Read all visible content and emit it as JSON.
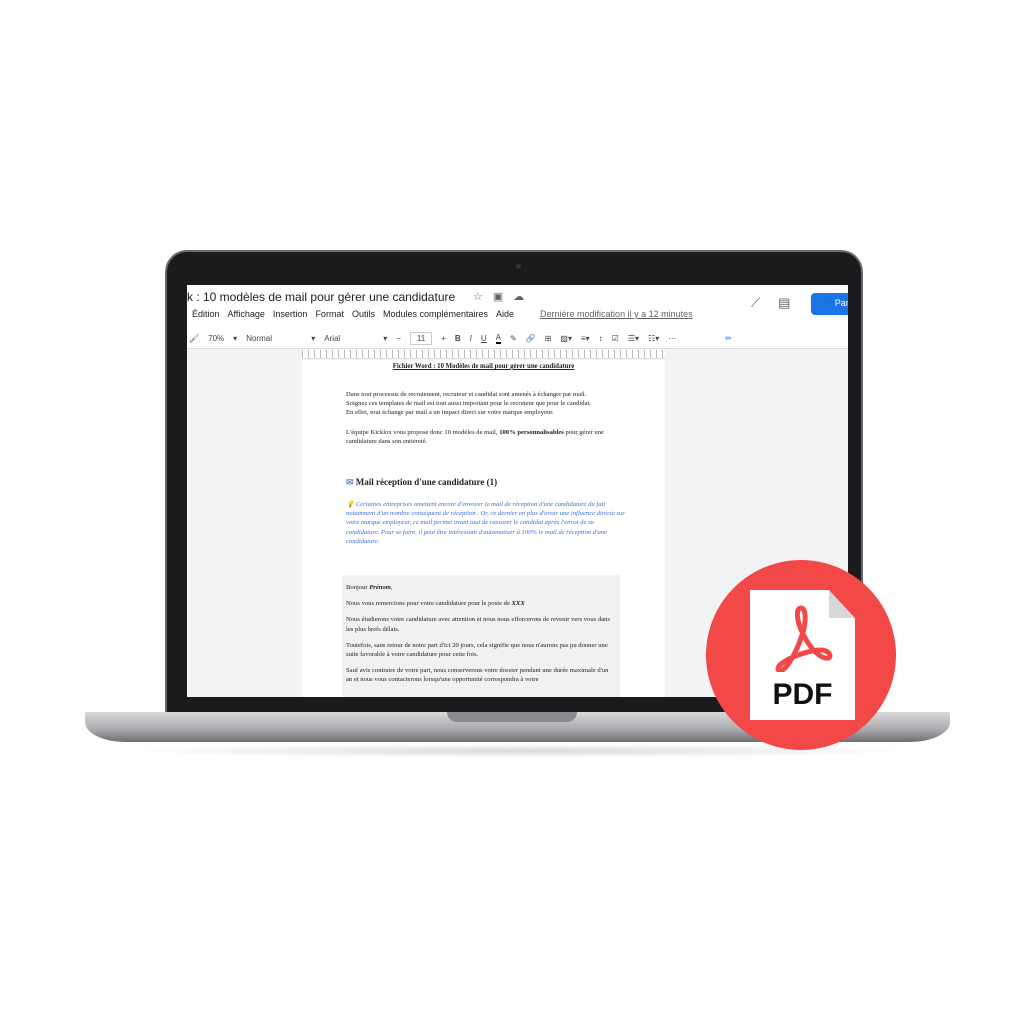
{
  "app": {
    "doc_title": "k :  10 modèles de mail pour gérer une candidature",
    "menu": [
      "Édition",
      "Affichage",
      "Insertion",
      "Format",
      "Outils",
      "Modules complémentaires",
      "Aide"
    ],
    "last_modified": "Dernière modification il y a 12 minutes",
    "share_label": "Par",
    "toolbar": {
      "zoom": "70%",
      "style": "Normal",
      "font": "Arial",
      "font_size": "11",
      "bold": "B",
      "italic": "I",
      "underline": "U",
      "text_color": "A"
    }
  },
  "document": {
    "title": "Fichier Word : 10 Modèles de mail pour gérer une candidature",
    "intro": [
      "Dans tout processus de recrutement, recruteur et candidat sont amenés à échanger par mail.",
      "Soignez ces templates de mail est tout aussi important pour le recruteur que pour le candidat.",
      "En effet, tout échange par mail a un impact direct sur votre marque employeur."
    ],
    "offer_pre": "L'équipe Kicklox vous propose donc 10 modèles de mail, ",
    "offer_bold": "100% personnalisables",
    "offer_post": " pour gérer une candidature dans son entièreté.",
    "section_title": "Mail réception d'une candidature (1)",
    "tip": "Certaines entreprises omettent encore d'envoyer le mail de réception d'une candidature du fait notamment d'un nombre conséquent de réception . Or, ce dernier en plus d'avoir une influence directe sur votre marque employeur, ce mail permet avant tout de rassurer le candidat après l'envoi de sa candidature. Pour se faire, il peut être intéressant d'automatiser à 100% le mail de réception d'une candidature.",
    "mail": {
      "greeting": "Bonjour ",
      "greeting_name": "Prénom",
      "line1": "Nous vous remercions pour votre candidature pour le poste de ",
      "line1_bold": "XXX",
      "line2": "Nous étudierons votre candidature avec attention et nous nous efforcerons de revenir vers vous dans les plus brefs délais.",
      "line3": "Toutefois, sans retour de notre part d'ici 20 jours, cela signifie que nous n'aurons pas pu donner une suite favorable à votre candidature pour cette fois.",
      "line4": "Sauf avis contraire de votre part, nous conserverons votre dossier pendant une durée maximale d'un an et nous vous contacterons lorsqu'une opportunité correspondra à votre"
    }
  },
  "badge": {
    "label": "PDF",
    "color": "#f24848"
  }
}
